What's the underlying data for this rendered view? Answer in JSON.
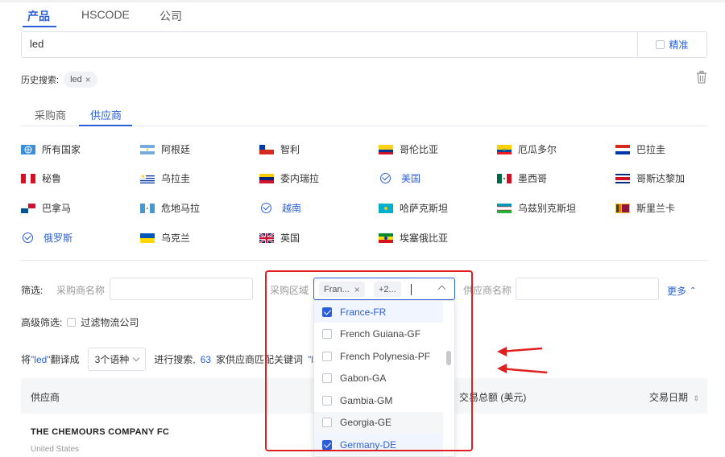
{
  "top_tabs": [
    {
      "label": "产品",
      "active": true
    },
    {
      "label": "HSCODE",
      "active": false
    },
    {
      "label": "公司",
      "active": false
    }
  ],
  "search": {
    "value": "led",
    "exact_label": "精准"
  },
  "history": {
    "label": "历史搜索:",
    "tags": [
      "led"
    ]
  },
  "sub_tabs": [
    {
      "label": "采购商",
      "active": false
    },
    {
      "label": "供应商",
      "active": true
    }
  ],
  "countries": [
    {
      "label": "所有国家",
      "flag": "globe",
      "selected": false
    },
    {
      "label": "阿根廷",
      "flag": "argentina",
      "selected": false
    },
    {
      "label": "智利",
      "flag": "chile",
      "selected": false
    },
    {
      "label": "哥伦比亚",
      "flag": "colombia",
      "selected": false
    },
    {
      "label": "厄瓜多尔",
      "flag": "ecuador",
      "selected": false
    },
    {
      "label": "巴拉圭",
      "flag": "paraguay",
      "selected": false
    },
    {
      "label": "秘鲁",
      "flag": "peru",
      "selected": false
    },
    {
      "label": "乌拉圭",
      "flag": "uruguay",
      "selected": false
    },
    {
      "label": "委内瑞拉",
      "flag": "venezuela",
      "selected": false
    },
    {
      "label": "美国",
      "flag": "check",
      "selected": true
    },
    {
      "label": "墨西哥",
      "flag": "mexico",
      "selected": false
    },
    {
      "label": "哥斯达黎加",
      "flag": "costa-rica",
      "selected": false
    },
    {
      "label": "巴拿马",
      "flag": "panama",
      "selected": false
    },
    {
      "label": "危地马拉",
      "flag": "guatemala",
      "selected": false
    },
    {
      "label": "越南",
      "flag": "check",
      "selected": true
    },
    {
      "label": "哈萨克斯坦",
      "flag": "kazakhstan",
      "selected": false
    },
    {
      "label": "乌兹别克斯坦",
      "flag": "uzbekistan",
      "selected": false
    },
    {
      "label": "斯里兰卡",
      "flag": "sri-lanka",
      "selected": false
    },
    {
      "label": "俄罗斯",
      "flag": "check",
      "selected": true
    },
    {
      "label": "乌克兰",
      "flag": "ukraine",
      "selected": false
    },
    {
      "label": "英国",
      "flag": "uk",
      "selected": false
    },
    {
      "label": "埃塞俄比亚",
      "flag": "ethiopia",
      "selected": false
    }
  ],
  "filters": {
    "label": "筛选:",
    "buyer_name_label": "采购商名称",
    "region_label": "采购区域",
    "region_tags": [
      "Fran...",
      "+2..."
    ],
    "supplier_name_label": "供应商名称",
    "more_label": "更多",
    "advanced_label": "高级筛选:",
    "filter_logistics_label": "过滤物流公司"
  },
  "translate": {
    "prefix": "将",
    "keyword_quoted": "\"led\"",
    "suffix1": "翻译成",
    "lang_select": "3个语种",
    "suffix2": "进行搜索,",
    "count": "63",
    "suffix3": "家供应商匹配关键词",
    "trail": "\"l"
  },
  "table": {
    "col_supplier": "供应商",
    "col_amount": "交易总额 (美元)",
    "col_date": "交易日期",
    "rows": [
      {
        "name": "THE CHEMOURS COMPANY FC",
        "country": "United States"
      }
    ]
  },
  "region_dropdown": {
    "options": [
      {
        "label": "France-FR",
        "checked": true
      },
      {
        "label": "French Guiana-GF",
        "checked": false
      },
      {
        "label": "French Polynesia-PF",
        "checked": false
      },
      {
        "label": "Gabon-GA",
        "checked": false
      },
      {
        "label": "Gambia-GM",
        "checked": false
      },
      {
        "label": "Georgia-GE",
        "checked": false
      },
      {
        "label": "Germany-DE",
        "checked": true
      }
    ]
  },
  "colors": {
    "accent": "#2b5fd9",
    "annotation": "#e02020"
  }
}
